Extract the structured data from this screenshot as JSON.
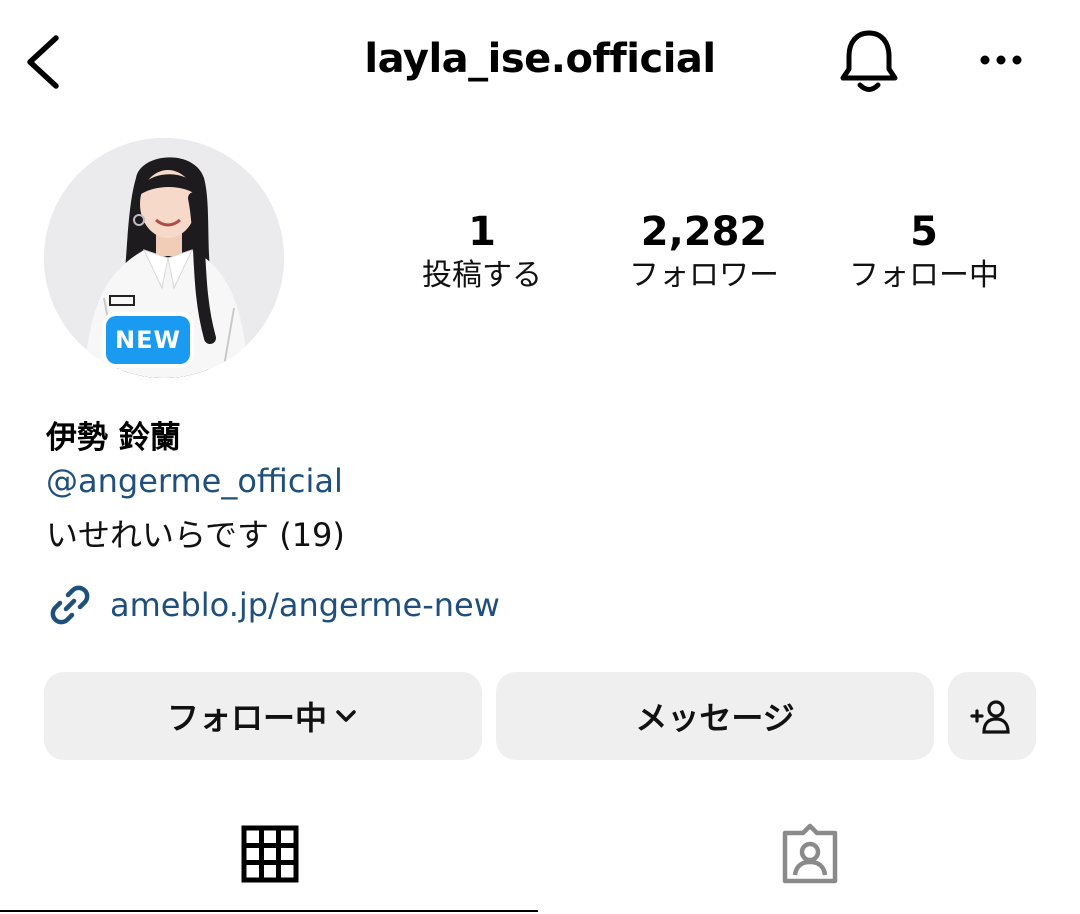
{
  "header": {
    "title": "layla_ise.official",
    "back_icon": "chevron-left-icon",
    "notification_icon": "bell-icon",
    "more_icon": "more-horizontal-icon"
  },
  "profile": {
    "avatar_badge": "NEW",
    "badge_color": "#1a9af0",
    "stats": [
      {
        "value": "1",
        "label": "投稿する"
      },
      {
        "value": "2,282",
        "label": "フォロワー"
      },
      {
        "value": "5",
        "label": "フォロー中"
      }
    ],
    "display_name": "伊勢 鈴蘭",
    "mention": "@angerme_official",
    "bio": "いせれいらです (19)",
    "link_icon": "link-icon",
    "link": "ameblo.jp/angerme-new",
    "link_color": "#1f4f7c"
  },
  "actions": {
    "follow_label": "フォロー中",
    "message_label": "メッセージ",
    "add_user_icon": "add-user-icon",
    "button_bg": "#efefef"
  },
  "tabs": [
    {
      "name": "grid",
      "icon": "grid-icon",
      "active": true
    },
    {
      "name": "tagged",
      "icon": "tagged-person-icon",
      "active": false
    }
  ]
}
